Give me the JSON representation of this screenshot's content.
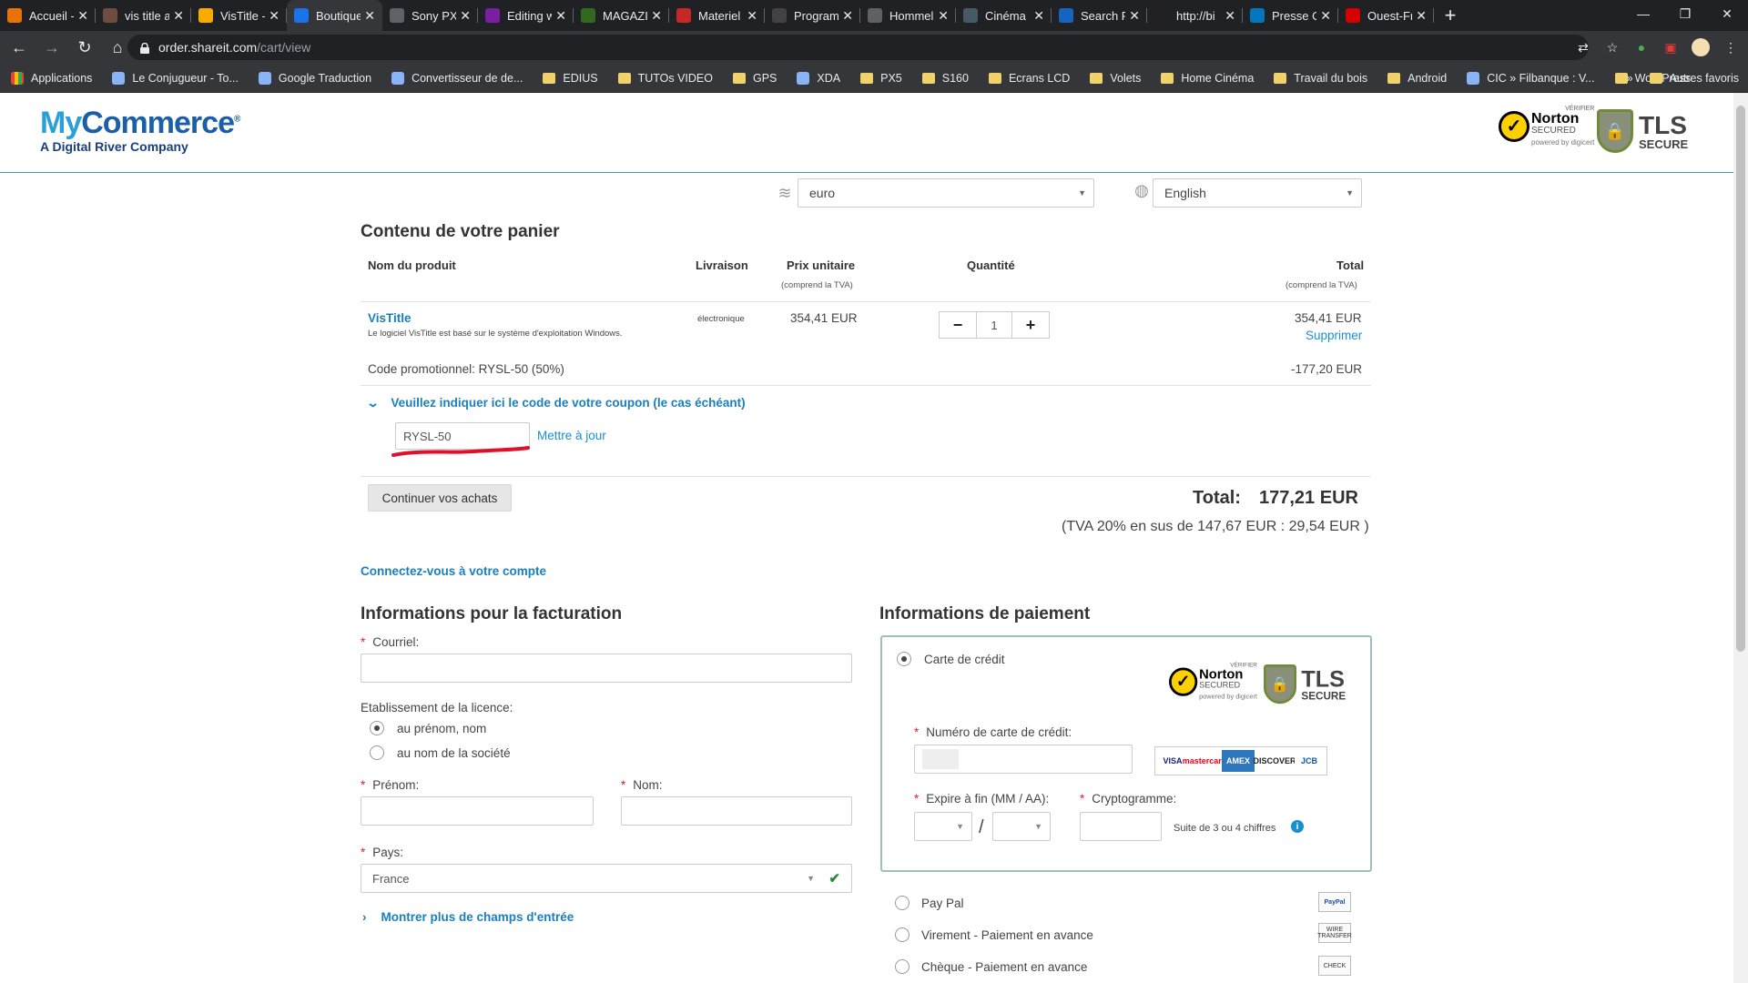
{
  "browser": {
    "tabs": [
      {
        "label": "Accueil - ",
        "color": "#e8710a"
      },
      {
        "label": "vis title a",
        "color": "#6d4c41"
      },
      {
        "label": "VisTitle - ",
        "color": "#f9ab00"
      },
      {
        "label": "Boutique",
        "color": "#1a73e8"
      },
      {
        "label": "Sony PXW",
        "color": "#5f6368"
      },
      {
        "label": "Editing w",
        "color": "#7b1fa2"
      },
      {
        "label": "MAGAZI",
        "color": "#33691e"
      },
      {
        "label": "Materiel",
        "color": "#c62828"
      },
      {
        "label": "Program",
        "color": "#424242"
      },
      {
        "label": "Hommel",
        "color": "#616161"
      },
      {
        "label": "Cinéma",
        "color": "#455a64"
      },
      {
        "label": "Search R",
        "color": "#1565c0"
      },
      {
        "label": "http://bi",
        "color": "#212121"
      },
      {
        "label": "Presse O",
        "color": "#0277bd"
      },
      {
        "label": "Ouest-Fr",
        "color": "#d50000"
      }
    ],
    "new_tab": "+",
    "url_host": "order.shareit.com",
    "url_path": "/cart/view",
    "bookmarks": [
      {
        "label": "Applications",
        "type": "apps"
      },
      {
        "label": "Le Conjugueur - To...",
        "type": "site"
      },
      {
        "label": "Google Traduction",
        "type": "site"
      },
      {
        "label": "Convertisseur de de...",
        "type": "site"
      },
      {
        "label": "EDIUS",
        "type": "folder"
      },
      {
        "label": "TUTOs VIDEO",
        "type": "folder"
      },
      {
        "label": "GPS",
        "type": "folder"
      },
      {
        "label": "XDA",
        "type": "site"
      },
      {
        "label": "PX5",
        "type": "folder"
      },
      {
        "label": "S160",
        "type": "folder"
      },
      {
        "label": "Ecrans LCD",
        "type": "folder"
      },
      {
        "label": "Volets",
        "type": "folder"
      },
      {
        "label": "Home Cinéma",
        "type": "folder"
      },
      {
        "label": "Travail du bois",
        "type": "folder"
      },
      {
        "label": "Android",
        "type": "folder"
      },
      {
        "label": "CIC » Filbanque : V...",
        "type": "site"
      },
      {
        "label": "WordPress",
        "type": "folder"
      }
    ],
    "bookmarks_more": "»",
    "other_bookmarks": "Autres favoris"
  },
  "header": {
    "logo_my": "My",
    "logo_commerce": "Commerce",
    "logo_tagline": "A Digital River Company",
    "norton": {
      "verify": "VÉRIFIER",
      "name": "Norton",
      "secured": "SECURED",
      "powered": "powered by digicert"
    },
    "tls": {
      "big": "TLS",
      "small": "SECURE"
    }
  },
  "selectors": {
    "currency": "euro",
    "language": "English"
  },
  "cart": {
    "title": "Contenu de votre panier",
    "col_product": "Nom du produit",
    "col_delivery": "Livraison",
    "col_unit_price": "Prix unitaire",
    "col_unit_price_sub": "(comprend la TVA)",
    "col_qty": "Quantité",
    "col_total": "Total",
    "col_total_sub": "(comprend la TVA)",
    "product_name": "VisTitle",
    "product_desc": "Le logiciel VisTitle est basé sur le système d'exploitation Windows.",
    "delivery": "électronique",
    "unit_price": "354,41 EUR",
    "qty": "1",
    "qty_minus": "−",
    "qty_plus": "+",
    "line_total": "354,41 EUR",
    "remove": "Supprimer",
    "promo_label": "Code promotionnel: RYSL-50 (50%)",
    "promo_amount": "-177,20 EUR",
    "coupon_toggle": "Veuillez indiquer ici le code de votre coupon (le cas échéant)",
    "coupon_value": "RYSL-50",
    "update": "Mettre à jour",
    "continue": "Continuer vos achats",
    "total_label": "Total:",
    "total_value": "177,21 EUR",
    "vat_note": "(TVA 20% en sus de 147,67 EUR : 29,54 EUR )",
    "login": "Connectez-vous à votre compte"
  },
  "billing": {
    "title": "Informations pour la facturation",
    "email_label": "Courriel:",
    "license_label": "Etablissement de la licence:",
    "license_opt1": "au prénom, nom",
    "license_opt2": "au nom de la société",
    "firstname_label": "Prénom:",
    "lastname_label": "Nom:",
    "country_label": "Pays:",
    "country_value": "France",
    "more_fields": "Montrer plus de champs d'entrée"
  },
  "payment": {
    "title": "Informations de paiement",
    "credit_card": "Carte de crédit",
    "card_number_label": "Numéro de carte de crédit:",
    "expiry_label": "Expire à fin (MM / AA):",
    "expiry_sep": "/",
    "cvv_label": "Cryptogramme:",
    "cvv_hint": "Suite de 3 ou 4 chiffres",
    "card_brands": [
      "VISA",
      "mastercard",
      "AMEX",
      "DISCOVER",
      "JCB"
    ],
    "paypal": "Pay Pal",
    "paypal_icon": "PayPal",
    "wire": "Virement - Paiement en avance",
    "wire_icon": "WIRE TRANSFER",
    "cheque": "Chèque - Paiement en avance",
    "cheque_icon": "CHECK"
  },
  "colors": {
    "accent": "#1a8fd0",
    "required": "#d9232d",
    "annotation": "#e0102a"
  }
}
